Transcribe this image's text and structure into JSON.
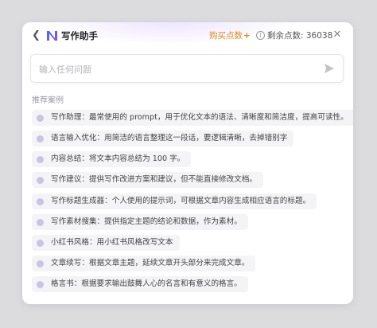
{
  "header": {
    "title": "写作助手",
    "buy_label": "购买点数",
    "buy_plus": "+",
    "remaining_label": "剩余点数: 36038"
  },
  "search": {
    "placeholder": "输入任何问题"
  },
  "section": {
    "label": "推荐案例"
  },
  "suggestions": [
    "写作助理：最常使用的 prompt，用于优化文本的语法、清晰度和简洁度，提高可读性。",
    "语言输入优化：用简洁的语言整理这一段话，要逻辑清晰，去掉错别字",
    "内容总结：将文本内容总结为 100 字。",
    "写作建议：提供写作改进方案和建议，但不能直接修改文档。",
    "写作标题生成器：个人使用的提示词，可根据文章内容生成相应语言的标题。",
    "写作素材搜集：提供指定主题的结论和数据，作为素材。",
    "小红书风格：用小红书风格改写文本",
    "文章续写：根据文章主题，延续文章开头部分来完成文章。",
    "格言书：根据要求输出鼓舞人心的名言和有意义的格言。"
  ],
  "colors": {
    "accent_orange": "#e08a1c",
    "dot": "#c9c3e6",
    "logo_blue": "#3b6cff",
    "logo_purple": "#8a4dff"
  },
  "icons": {
    "back": "chevron-left-icon",
    "logo": "app-logo-icon",
    "info": "info-icon",
    "close": "close-icon",
    "send": "send-icon",
    "bullet": "dot-icon"
  }
}
